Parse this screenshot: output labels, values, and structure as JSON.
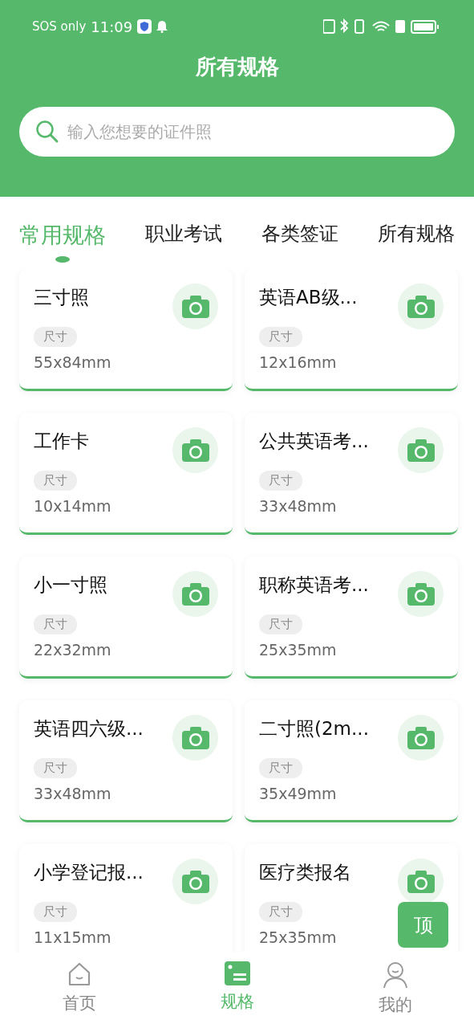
{
  "status_bar": {
    "carrier": "SOS only",
    "time": "11:09"
  },
  "header": {
    "title": "所有规格",
    "search": {
      "placeholder": "输入您想要的证件照"
    }
  },
  "tabs": [
    {
      "label": "常用规格",
      "selected": true
    },
    {
      "label": "职业考试",
      "selected": false
    },
    {
      "label": "各类签证",
      "selected": false
    },
    {
      "label": "所有规格",
      "selected": false
    }
  ],
  "specs": [
    {
      "name": "三寸照",
      "tag": "尺寸",
      "size": "55x84mm"
    },
    {
      "name": "英语AB级...",
      "tag": "尺寸",
      "size": "12x16mm"
    },
    {
      "name": "工作卡",
      "tag": "尺寸",
      "size": "10x14mm"
    },
    {
      "name": "公共英语考...",
      "tag": "尺寸",
      "size": "33x48mm"
    },
    {
      "name": "小一寸照",
      "tag": "尺寸",
      "size": "22x32mm"
    },
    {
      "name": "职称英语考...",
      "tag": "尺寸",
      "size": "25x35mm"
    },
    {
      "name": "英语四六级...",
      "tag": "尺寸",
      "size": "33x48mm"
    },
    {
      "name": "二寸照(2m...",
      "tag": "尺寸",
      "size": "35x49mm"
    },
    {
      "name": "小学登记报...",
      "tag": "尺寸",
      "size": "11x15mm"
    },
    {
      "name": "医疗类报名",
      "tag": "尺寸",
      "size": "25x35mm"
    }
  ],
  "top_button": {
    "label": "顶"
  },
  "nav": [
    {
      "label": "首页",
      "selected": false,
      "kind": "home"
    },
    {
      "label": "规格",
      "selected": true,
      "kind": "specs"
    },
    {
      "label": "我的",
      "selected": false,
      "kind": "profile"
    }
  ]
}
